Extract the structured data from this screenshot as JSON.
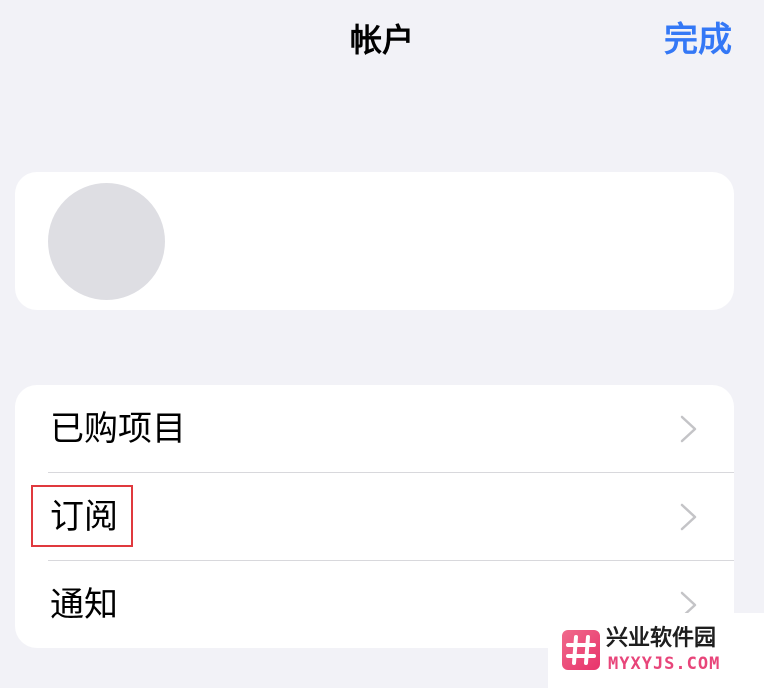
{
  "nav": {
    "title": "帐户",
    "done_label": "完成"
  },
  "menu": {
    "items": [
      {
        "label": "已购项目"
      },
      {
        "label": "订阅"
      },
      {
        "label": "通知"
      }
    ]
  },
  "watermark": {
    "title": "兴业软件园",
    "domain": "MYXYJS.COM"
  },
  "colors": {
    "accent": "#3478f6",
    "background": "#f2f2f7",
    "highlight": "#e0393e",
    "watermark_pink": "#e8457a"
  }
}
